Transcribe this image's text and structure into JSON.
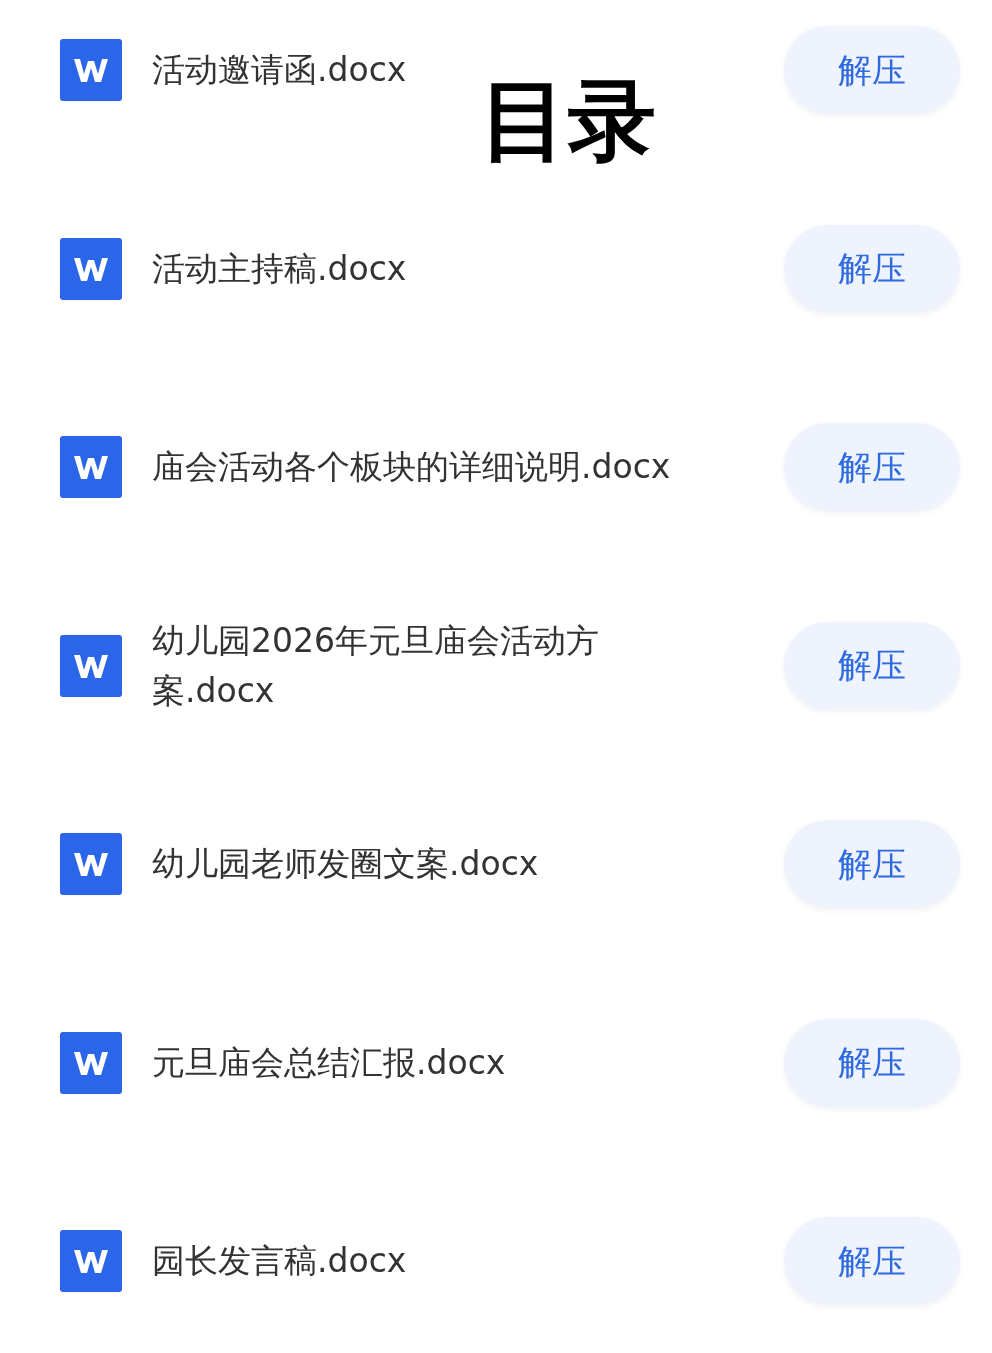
{
  "title": "目录",
  "files": [
    {
      "name": "活动邀请函.docx",
      "action": "解压"
    },
    {
      "name": "活动主持稿.docx",
      "action": "解压"
    },
    {
      "name": "庙会活动各个板块的详细说明.docx",
      "action": "解压"
    },
    {
      "name": "幼儿园2026年元旦庙会活动方案.docx",
      "action": "解压"
    },
    {
      "name": "幼儿园老师发圈文案.docx",
      "action": "解压"
    },
    {
      "name": "元旦庙会总结汇报.docx",
      "action": "解压"
    },
    {
      "name": "园长发言稿.docx",
      "action": "解压"
    }
  ]
}
